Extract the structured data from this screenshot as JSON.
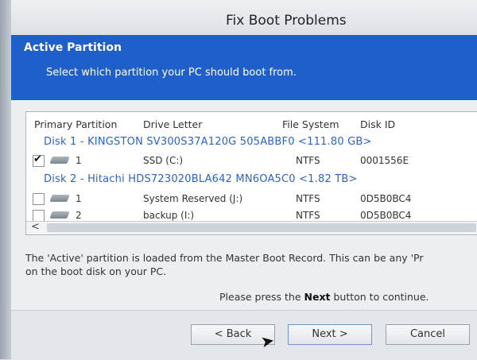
{
  "window": {
    "title": "Fix Boot Problems"
  },
  "header": {
    "title": "Active Partition",
    "subtitle": "Select which partition your PC should boot from."
  },
  "table": {
    "columns": [
      "Primary Partition",
      "Drive Letter",
      "File System",
      "Disk ID"
    ],
    "disks": [
      {
        "label": "Disk 1 - KINGSTON SV300S37A120G 505ABBF0  <111.80 GB>"
      },
      {
        "label": "Disk 2 - Hitachi HDS723020BLA642 MN6OA5C0  <1.82 TB>"
      }
    ],
    "partitions": [
      {
        "number": "1",
        "drive": "SSD (C:)",
        "fs": "NTFS",
        "id": "0001556E",
        "checked": true
      },
      {
        "number": "1",
        "drive": "System Reserved (J:)",
        "fs": "NTFS",
        "id": "0D5B0BC4",
        "checked": false
      },
      {
        "number": "2",
        "drive": "backup (I:)",
        "fs": "NTFS",
        "id": "0D5B0BC4",
        "checked": false
      }
    ],
    "scroll_left_glyph": "<"
  },
  "info": {
    "line1": "The 'Active' partition is loaded from the Master Boot Record. This can be any 'Pr",
    "line2": "on the boot disk on your PC."
  },
  "prompt": {
    "before": "Please press the ",
    "bold": "Next",
    "after": " button to continue."
  },
  "buttons": {
    "back": "< Back",
    "next": "Next >",
    "cancel": "Cancel"
  }
}
